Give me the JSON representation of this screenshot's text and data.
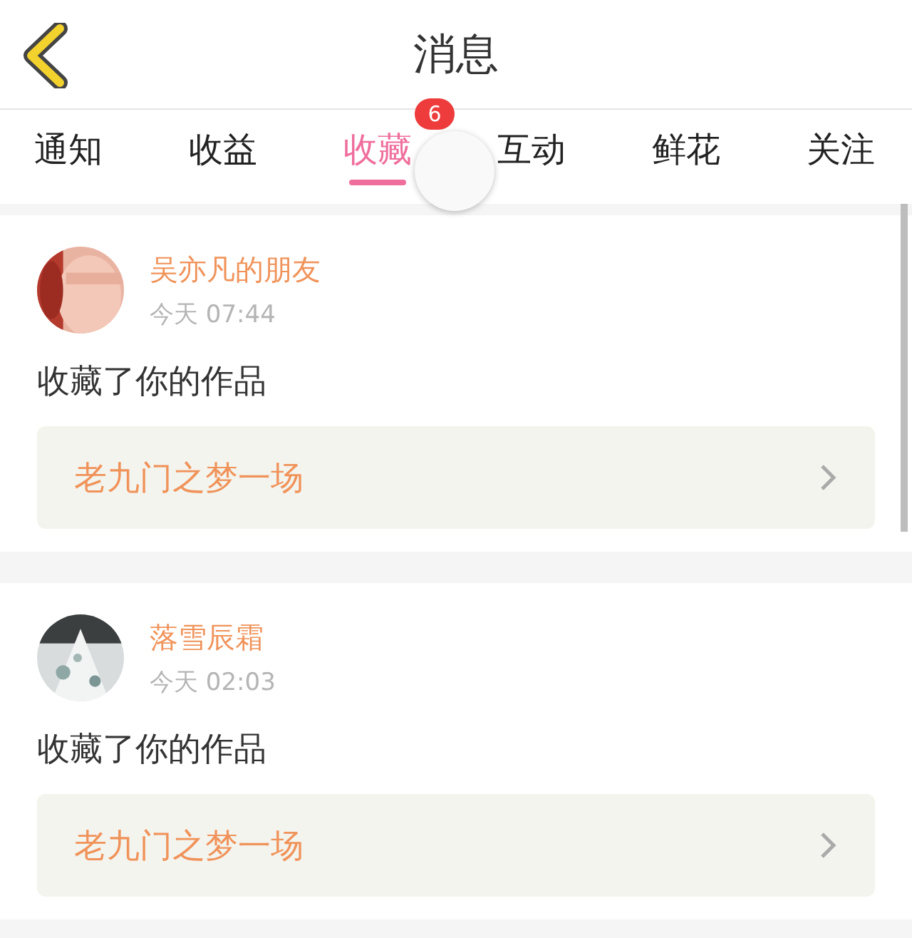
{
  "header": {
    "title": "消息"
  },
  "tabs": [
    {
      "label": "通知",
      "selected": false
    },
    {
      "label": "收益",
      "selected": false
    },
    {
      "label": "收藏",
      "selected": true,
      "badge": "6"
    },
    {
      "label": "互动",
      "selected": false
    },
    {
      "label": "鲜花",
      "selected": false
    },
    {
      "label": "关注",
      "selected": false
    }
  ],
  "messages": [
    {
      "name": "吴亦凡的朋友",
      "time": "今天 07:44",
      "action": "收藏了你的作品",
      "work_title": "老九门之梦一场"
    },
    {
      "name": "落雪辰霜",
      "time": "今天 02:03",
      "action": "收藏了你的作品",
      "work_title": "老九门之梦一场"
    }
  ]
}
